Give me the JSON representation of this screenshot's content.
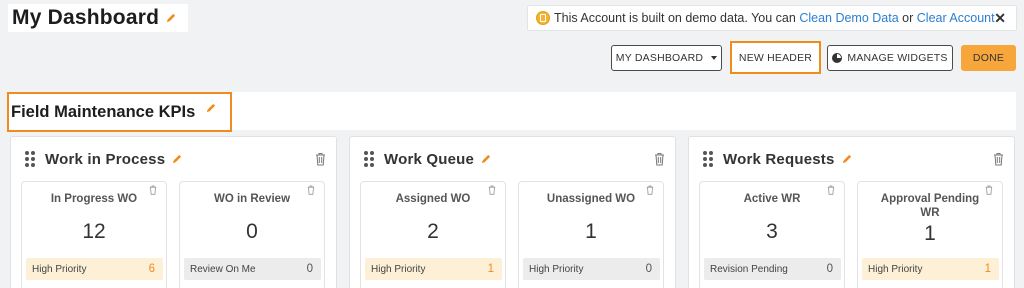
{
  "header": {
    "title": "My Dashboard"
  },
  "notice": {
    "text": "This Account is built on demo data. You can",
    "link1": "Clean Demo Data",
    "middle": "or",
    "link2": "Clear Account",
    "close": "✕"
  },
  "toolbar": {
    "dashboard_select": "MY DASHBOARD",
    "new_header": "NEW HEADER",
    "manage_widgets": "MANAGE WIDGETS",
    "done": "DONE"
  },
  "section": {
    "title": "Field Maintenance KPIs"
  },
  "widgets": [
    {
      "title": "Work in Process",
      "kpis": [
        {
          "label": "In Progress WO",
          "value": "12",
          "footer_label": "High Priority",
          "footer_value": "6",
          "footer_style": "orange"
        },
        {
          "label": "WO in Review",
          "value": "0",
          "footer_label": "Review On Me",
          "footer_value": "0",
          "footer_style": "grey"
        }
      ]
    },
    {
      "title": "Work Queue",
      "kpis": [
        {
          "label": "Assigned WO",
          "value": "2",
          "footer_label": "High Priority",
          "footer_value": "1",
          "footer_style": "orange"
        },
        {
          "label": "Unassigned WO",
          "value": "1",
          "footer_label": "High Priority",
          "footer_value": "0",
          "footer_style": "grey"
        }
      ]
    },
    {
      "title": "Work Requests",
      "kpis": [
        {
          "label": "Active WR",
          "value": "3",
          "footer_label": "Revision Pending",
          "footer_value": "0",
          "footer_style": "grey"
        },
        {
          "label": "Approval Pending WR",
          "value": "1",
          "footer_label": "High Priority",
          "footer_value": "1",
          "footer_style": "orange"
        }
      ]
    }
  ],
  "colors": {
    "accent": "#f08c1d",
    "done_button": "#f7a63c",
    "link": "#2d7dd2",
    "coin": "#f3b431"
  },
  "icons": {
    "edit": "pencil-icon",
    "drag": "drag-handle-icon",
    "delete": "trash-icon",
    "notice": "coin-icon",
    "manage": "pie-chart-icon"
  }
}
